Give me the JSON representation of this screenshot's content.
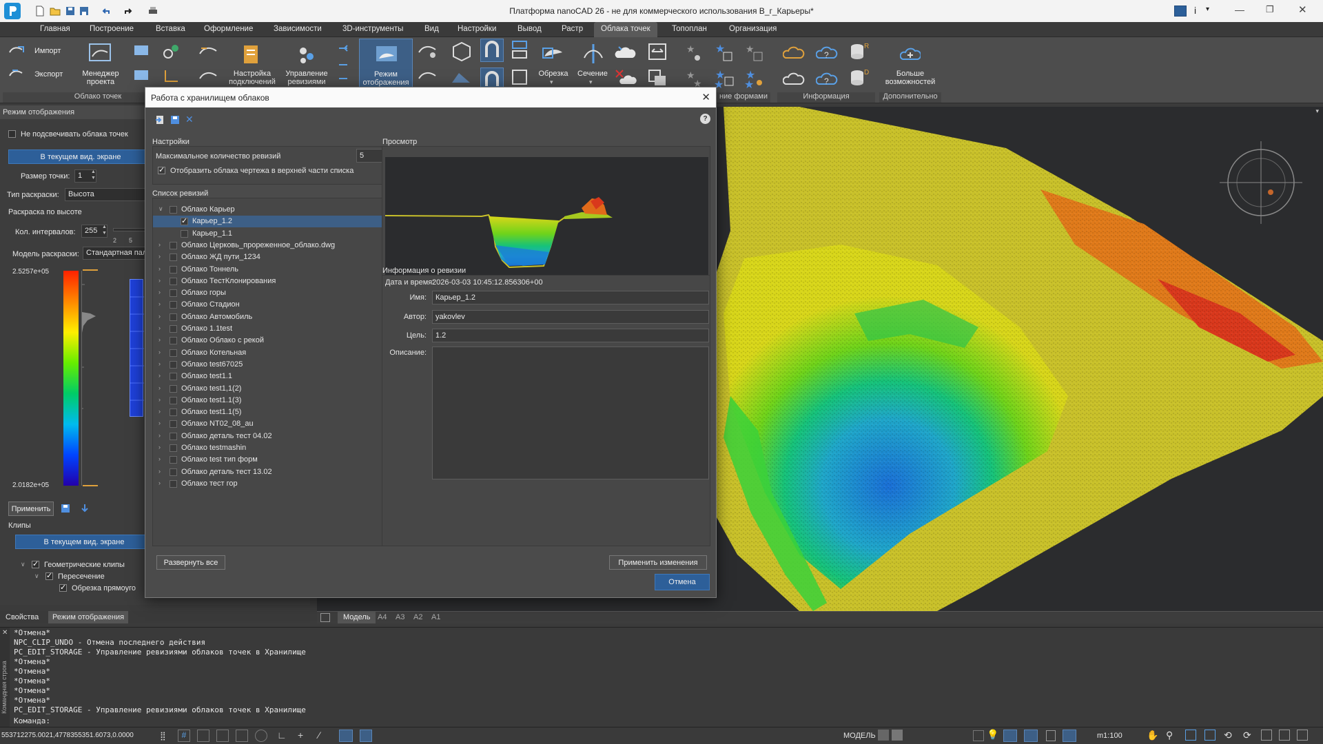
{
  "app": {
    "title": "Платформа nanoCAD 26 - не для коммерческого использования В_г_Карьеры*"
  },
  "menu": {
    "tabs": [
      "Главная",
      "Построение",
      "Вставка",
      "Оформление",
      "Зависимости",
      "3D-инструменты",
      "Вид",
      "Настройки",
      "Вывод",
      "Растр",
      "Облака точек",
      "Топоплан",
      "Организация"
    ],
    "active": "Облака точек"
  },
  "ribbon": {
    "import": "Импорт",
    "export": "Экспорт",
    "project_manager": [
      "Менеджер",
      "проекта"
    ],
    "conn_settings": [
      "Настройка",
      "подключений"
    ],
    "revisions": [
      "Управление",
      "ревизиями"
    ],
    "display_mode": [
      "Режим",
      "отображения"
    ],
    "trim": "Обрезка",
    "section": "Сечение",
    "more": [
      "Больше",
      "возможностей"
    ],
    "groups": {
      "cloud": "Облако точек",
      "forms": "ние формами",
      "info": "Информация",
      "extra": "Дополнительно"
    }
  },
  "left_panel": {
    "header": "Режим отображения",
    "no_highlight": "Не подсвечивать облака точек",
    "current_view_btn": "В текущем вид. экране",
    "point_size_label": "Размер точки:",
    "point_size": "1",
    "color_type_label": "Тип раскраски:",
    "color_type": "Высота",
    "height_coloring": "Раскраска по высоте",
    "intervals_label": "Кол. интервалов:",
    "intervals": "255",
    "slider_ticks": [
      "2",
      "5"
    ],
    "color_model_label": "Модель раскраски:",
    "color_model": "Стандартная пал",
    "max_value": "2.5257e+05",
    "min_value": "2.0182e+05",
    "apply": "Применить",
    "clips": "Клипы",
    "clips_view_btn": "В текущем вид. экране",
    "geo_clips": "Геометрические клипы",
    "intersection": "Пересечение",
    "rect_trim": "Обрезка прямоуго",
    "tabs": [
      "Свойства",
      "Режим отображения"
    ]
  },
  "dialog": {
    "title": "Работа с хранилищем облаков",
    "settings": "Настройки",
    "max_revisions_label": "Максимальное количество ревизий",
    "max_revisions": "5",
    "show_drawing_clouds": "Отобразить облака чертежа в верхней части списка",
    "revisions_list": "Список ревизий",
    "tree": [
      {
        "label": "Облако Карьер",
        "level": 0,
        "expanded": true
      },
      {
        "label": "Карьер_1.2",
        "level": 1,
        "checked": true,
        "selected": true
      },
      {
        "label": "Карьер_1.1",
        "level": 1
      },
      {
        "label": "Облако Церковь_прореженное_облако.dwg",
        "level": 0
      },
      {
        "label": "Облако ЖД пути_1234",
        "level": 0
      },
      {
        "label": "Облако Тоннель",
        "level": 0
      },
      {
        "label": "Облако ТестКлонирования",
        "level": 0
      },
      {
        "label": "Облако горы",
        "level": 0
      },
      {
        "label": "Облако Стадион",
        "level": 0
      },
      {
        "label": "Облако Автомобиль",
        "level": 0
      },
      {
        "label": "Облако 1.1test",
        "level": 0
      },
      {
        "label": "Облако Облако с рекой",
        "level": 0
      },
      {
        "label": "Облако Котельная",
        "level": 0
      },
      {
        "label": "Облако test67025",
        "level": 0
      },
      {
        "label": "Облако test1.1",
        "level": 0
      },
      {
        "label": "Облако test1,1(2)",
        "level": 0
      },
      {
        "label": "Облако test1.1(3)",
        "level": 0
      },
      {
        "label": "Облако test1.1(5)",
        "level": 0
      },
      {
        "label": "Облако NT02_08_au",
        "level": 0
      },
      {
        "label": "Облако деталь тест 04.02",
        "level": 0
      },
      {
        "label": "Облако testmashin",
        "level": 0
      },
      {
        "label": "Облако test тип форм",
        "level": 0
      },
      {
        "label": "Облако деталь тест 13.02",
        "level": 0
      },
      {
        "label": "Облако тест гор",
        "level": 0
      }
    ],
    "expand_all": "Развернуть все",
    "preview": "Просмотр",
    "rev_info": "Информация о ревизии",
    "datetime_label": "Дата и время:",
    "datetime": "2026-03-03 10:45:12.856306+00",
    "name_label": "Имя:",
    "name": "Карьер_1.2",
    "author_label": "Автор:",
    "author": "yakovlev",
    "goal_label": "Цель:",
    "goal": "1.2",
    "desc_label": "Описание:",
    "apply_changes": "Применить изменения",
    "cancel": "Отмена"
  },
  "viewport_tabs": [
    "Модель",
    "A4",
    "A3",
    "A2",
    "A1"
  ],
  "command_lines": [
    "*Отмена*",
    "NPC_CLIP_UNDO - Отмена последнего действия",
    "PC_EDIT_STORAGE - Управление ревизиями облаков точек в Хранилище",
    "*Отмена*",
    "*Отмена*",
    "*Отмена*",
    "*Отмена*",
    "*Отмена*",
    "PC_EDIT_STORAGE - Управление ревизиями облаков точек в Хранилище"
  ],
  "command_prompt": "Команда:",
  "command_side_label": "Командная строка",
  "status": {
    "coords": "553712275.0021,4778355351.6073,0.0000",
    "model": "МОДЕЛЬ",
    "scale": "m1:100"
  },
  "colors": {
    "accent": "#2d5f99",
    "dialog_bg": "#4b4b4b",
    "ribbon_bg": "#4d4d4d"
  }
}
